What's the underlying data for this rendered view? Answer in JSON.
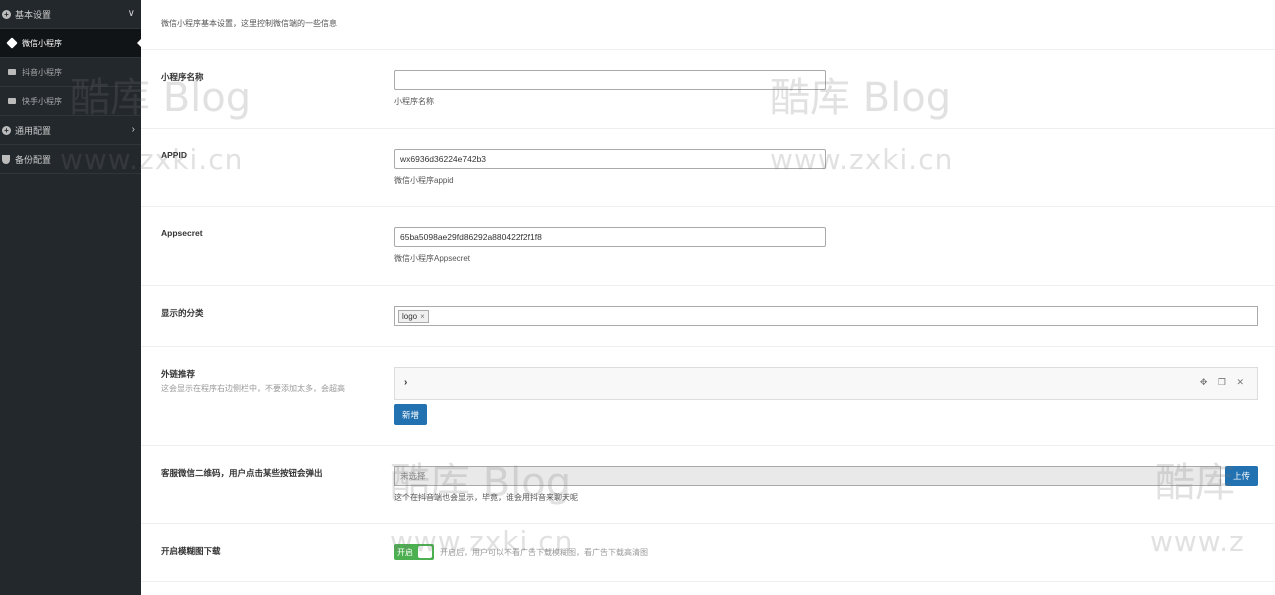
{
  "sidebar": {
    "groups": [
      {
        "label": "基本设置",
        "icon": "plus-circle-icon",
        "chevron": "∨"
      },
      {
        "label": "通用配置",
        "icon": "plus-circle-icon",
        "chevron": "›"
      },
      {
        "label": "备份配置",
        "icon": "shield-icon"
      }
    ],
    "items": [
      {
        "label": "微信小程序",
        "icon": "tag-icon",
        "active": true
      },
      {
        "label": "抖音小程序",
        "icon": "video-icon"
      },
      {
        "label": "快手小程序",
        "icon": "video-icon"
      }
    ]
  },
  "main": {
    "intro": "微信小程序基本设置，这里控制微信端的一些信息",
    "fields": {
      "name": {
        "label": "小程序名称",
        "value": "",
        "desc": "小程序名称"
      },
      "appid": {
        "label": "APPID",
        "value": "wx6936d36224e742b3",
        "desc": "微信小程序appid"
      },
      "appsecret": {
        "label": "Appsecret",
        "value": "65ba5098ae29fd86292a880422f2f1f8",
        "desc": "微信小程序Appsecret"
      },
      "category": {
        "label": "显示的分类",
        "tags": [
          "logo"
        ],
        "tag_remove": "×"
      },
      "links": {
        "label": "外链推荐",
        "sub": "这会显示在程序右边侧栏中，不要添加太多，会超高",
        "arrow": "›",
        "tools": "✥ ❐ ✕",
        "add_label": "新增"
      },
      "qrcode": {
        "label": "客服微信二维码，用户点击某些按钮会弹出",
        "value": "未选择",
        "upload_label": "上传",
        "desc": "这个在抖音端也会显示，毕竟，谁会用抖音来聊天呢"
      },
      "blur_download": {
        "label": "开启模糊图下载",
        "switch_label": "开启",
        "desc": "开启后，用户可以不看广告下载模糊图，看广告下载高清图"
      }
    }
  },
  "watermarks": {
    "brand": "酷库 Blog",
    "brand_short": "酷库",
    "url": "www.zxki.cn",
    "url_short": "www.z"
  }
}
